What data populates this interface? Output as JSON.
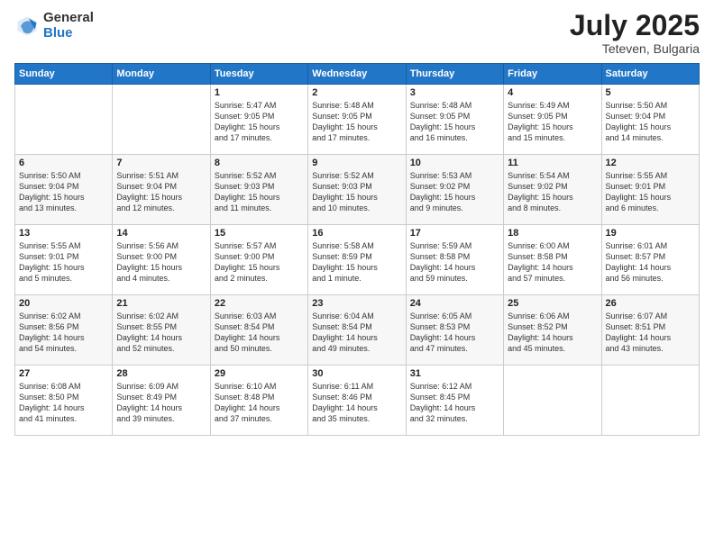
{
  "header": {
    "logo_general": "General",
    "logo_blue": "Blue",
    "month": "July 2025",
    "location": "Teteven, Bulgaria"
  },
  "weekdays": [
    "Sunday",
    "Monday",
    "Tuesday",
    "Wednesday",
    "Thursday",
    "Friday",
    "Saturday"
  ],
  "weeks": [
    [
      {
        "day": "",
        "info": ""
      },
      {
        "day": "",
        "info": ""
      },
      {
        "day": "1",
        "info": "Sunrise: 5:47 AM\nSunset: 9:05 PM\nDaylight: 15 hours\nand 17 minutes."
      },
      {
        "day": "2",
        "info": "Sunrise: 5:48 AM\nSunset: 9:05 PM\nDaylight: 15 hours\nand 17 minutes."
      },
      {
        "day": "3",
        "info": "Sunrise: 5:48 AM\nSunset: 9:05 PM\nDaylight: 15 hours\nand 16 minutes."
      },
      {
        "day": "4",
        "info": "Sunrise: 5:49 AM\nSunset: 9:05 PM\nDaylight: 15 hours\nand 15 minutes."
      },
      {
        "day": "5",
        "info": "Sunrise: 5:50 AM\nSunset: 9:04 PM\nDaylight: 15 hours\nand 14 minutes."
      }
    ],
    [
      {
        "day": "6",
        "info": "Sunrise: 5:50 AM\nSunset: 9:04 PM\nDaylight: 15 hours\nand 13 minutes."
      },
      {
        "day": "7",
        "info": "Sunrise: 5:51 AM\nSunset: 9:04 PM\nDaylight: 15 hours\nand 12 minutes."
      },
      {
        "day": "8",
        "info": "Sunrise: 5:52 AM\nSunset: 9:03 PM\nDaylight: 15 hours\nand 11 minutes."
      },
      {
        "day": "9",
        "info": "Sunrise: 5:52 AM\nSunset: 9:03 PM\nDaylight: 15 hours\nand 10 minutes."
      },
      {
        "day": "10",
        "info": "Sunrise: 5:53 AM\nSunset: 9:02 PM\nDaylight: 15 hours\nand 9 minutes."
      },
      {
        "day": "11",
        "info": "Sunrise: 5:54 AM\nSunset: 9:02 PM\nDaylight: 15 hours\nand 8 minutes."
      },
      {
        "day": "12",
        "info": "Sunrise: 5:55 AM\nSunset: 9:01 PM\nDaylight: 15 hours\nand 6 minutes."
      }
    ],
    [
      {
        "day": "13",
        "info": "Sunrise: 5:55 AM\nSunset: 9:01 PM\nDaylight: 15 hours\nand 5 minutes."
      },
      {
        "day": "14",
        "info": "Sunrise: 5:56 AM\nSunset: 9:00 PM\nDaylight: 15 hours\nand 4 minutes."
      },
      {
        "day": "15",
        "info": "Sunrise: 5:57 AM\nSunset: 9:00 PM\nDaylight: 15 hours\nand 2 minutes."
      },
      {
        "day": "16",
        "info": "Sunrise: 5:58 AM\nSunset: 8:59 PM\nDaylight: 15 hours\nand 1 minute."
      },
      {
        "day": "17",
        "info": "Sunrise: 5:59 AM\nSunset: 8:58 PM\nDaylight: 14 hours\nand 59 minutes."
      },
      {
        "day": "18",
        "info": "Sunrise: 6:00 AM\nSunset: 8:58 PM\nDaylight: 14 hours\nand 57 minutes."
      },
      {
        "day": "19",
        "info": "Sunrise: 6:01 AM\nSunset: 8:57 PM\nDaylight: 14 hours\nand 56 minutes."
      }
    ],
    [
      {
        "day": "20",
        "info": "Sunrise: 6:02 AM\nSunset: 8:56 PM\nDaylight: 14 hours\nand 54 minutes."
      },
      {
        "day": "21",
        "info": "Sunrise: 6:02 AM\nSunset: 8:55 PM\nDaylight: 14 hours\nand 52 minutes."
      },
      {
        "day": "22",
        "info": "Sunrise: 6:03 AM\nSunset: 8:54 PM\nDaylight: 14 hours\nand 50 minutes."
      },
      {
        "day": "23",
        "info": "Sunrise: 6:04 AM\nSunset: 8:54 PM\nDaylight: 14 hours\nand 49 minutes."
      },
      {
        "day": "24",
        "info": "Sunrise: 6:05 AM\nSunset: 8:53 PM\nDaylight: 14 hours\nand 47 minutes."
      },
      {
        "day": "25",
        "info": "Sunrise: 6:06 AM\nSunset: 8:52 PM\nDaylight: 14 hours\nand 45 minutes."
      },
      {
        "day": "26",
        "info": "Sunrise: 6:07 AM\nSunset: 8:51 PM\nDaylight: 14 hours\nand 43 minutes."
      }
    ],
    [
      {
        "day": "27",
        "info": "Sunrise: 6:08 AM\nSunset: 8:50 PM\nDaylight: 14 hours\nand 41 minutes."
      },
      {
        "day": "28",
        "info": "Sunrise: 6:09 AM\nSunset: 8:49 PM\nDaylight: 14 hours\nand 39 minutes."
      },
      {
        "day": "29",
        "info": "Sunrise: 6:10 AM\nSunset: 8:48 PM\nDaylight: 14 hours\nand 37 minutes."
      },
      {
        "day": "30",
        "info": "Sunrise: 6:11 AM\nSunset: 8:46 PM\nDaylight: 14 hours\nand 35 minutes."
      },
      {
        "day": "31",
        "info": "Sunrise: 6:12 AM\nSunset: 8:45 PM\nDaylight: 14 hours\nand 32 minutes."
      },
      {
        "day": "",
        "info": ""
      },
      {
        "day": "",
        "info": ""
      }
    ]
  ]
}
